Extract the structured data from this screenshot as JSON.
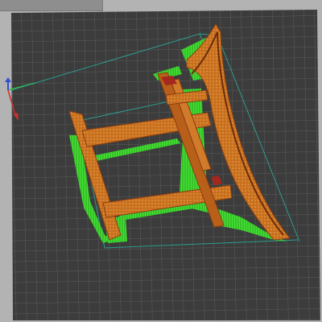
{
  "app": {
    "view": "3d-layer-preview"
  },
  "colors": {
    "background": "#b3b3b3",
    "bed": "#3d3d3d",
    "grid": "#5a5a5a",
    "model_orange": "#c8701f",
    "model_dark": "#8a3d12",
    "support_green": "#3cd62e",
    "bounding_box": "#2d9c8e",
    "axis_x": "#d03030",
    "axis_y": "#30c030",
    "axis_z": "#3050d0"
  },
  "icons": {
    "axis_gizmo": "axes-icon"
  },
  "toolbar": {
    "visible": true
  }
}
